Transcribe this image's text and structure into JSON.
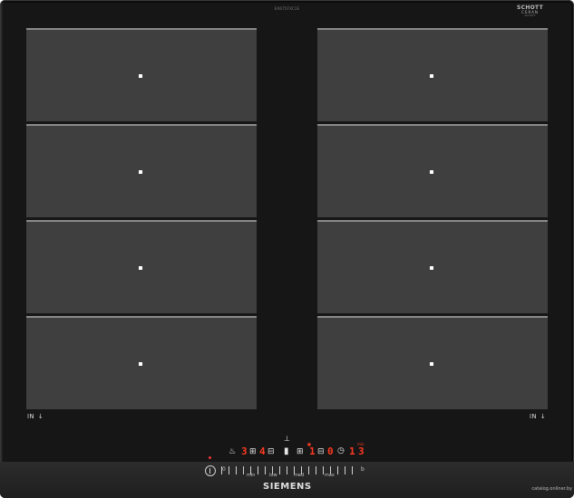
{
  "cooktop": {
    "model_number": "EX675FXC1E",
    "glass_brand_line1": "SCHOTT",
    "glass_brand_line2": "CERAN",
    "glass_brand_line3": "SCHOTT"
  },
  "zones": {
    "left_in_label": "IN",
    "right_in_label": "IN"
  },
  "controls": {
    "displays": [
      "3",
      "4",
      "1",
      "0",
      "1",
      "3"
    ],
    "unit_label": "min",
    "slider_labels": [
      "0",
      "min",
      "low",
      "med",
      "max",
      "b"
    ]
  },
  "branding": {
    "manufacturer": "SIEMENS",
    "source": "catalog.onliner.by"
  },
  "colors": {
    "glass": "#161616",
    "zone_surface": "#3f3f3f",
    "led_red": "#ff3a20"
  }
}
